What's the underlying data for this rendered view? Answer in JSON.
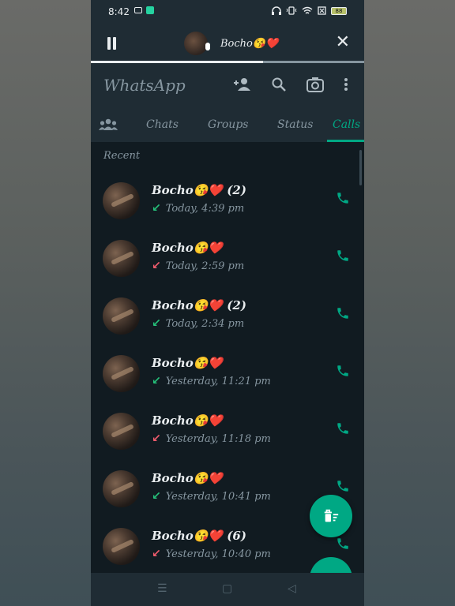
{
  "status_bar": {
    "time": "8:42",
    "battery": "88"
  },
  "voice_banner": {
    "name": "Bocho😘❤️"
  },
  "header": {
    "title": "WhatsApp"
  },
  "tabs": [
    {
      "label": "Chats"
    },
    {
      "label": "Groups"
    },
    {
      "label": "Status"
    },
    {
      "label": "Calls"
    }
  ],
  "list": {
    "section_label": "Recent",
    "calls": [
      {
        "name": "Bocho😘❤️ (2)",
        "time": "Today, 4:39 pm",
        "direction": "incoming"
      },
      {
        "name": "Bocho😘❤️",
        "time": "Today, 2:59 pm",
        "direction": "missed"
      },
      {
        "name": "Bocho😘❤️ (2)",
        "time": "Today, 2:34 pm",
        "direction": "incoming"
      },
      {
        "name": "Bocho😘❤️",
        "time": "Yesterday, 11:21 pm",
        "direction": "incoming"
      },
      {
        "name": "Bocho😘❤️",
        "time": "Yesterday, 11:18 pm",
        "direction": "missed"
      },
      {
        "name": "Bocho😘❤️",
        "time": "Yesterday, 10:41 pm",
        "direction": "incoming"
      },
      {
        "name": "Bocho😘❤️ (6)",
        "time": "Yesterday, 10:40 pm",
        "direction": "missed"
      }
    ]
  },
  "icons": {
    "arrow_incoming": "↙",
    "arrow_missed": "↙"
  },
  "colors": {
    "accent": "#00a884",
    "incoming": "#25c17a",
    "missed": "#f15c6d",
    "background": "#111b21",
    "header": "#1f2c34"
  }
}
